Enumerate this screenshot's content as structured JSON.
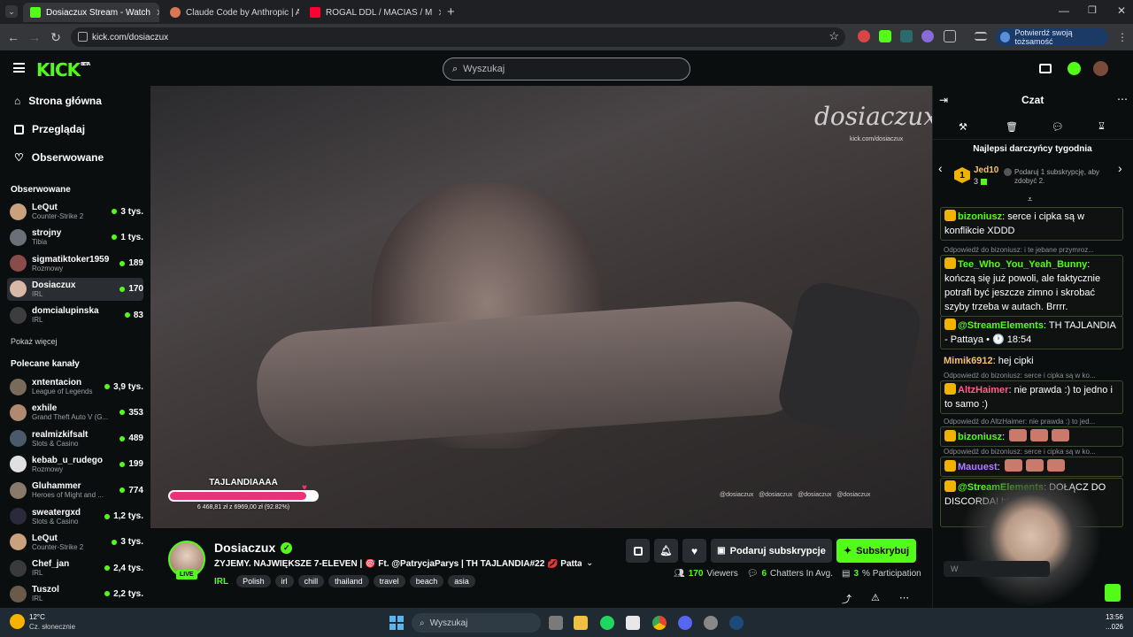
{
  "browser": {
    "tabs": [
      {
        "title": "Dosiaczux Stream - Watch",
        "active": true
      },
      {
        "title": "Claude Code by Anthropic | AI",
        "active": false
      },
      {
        "title": "ROGAL DDL / MACIAS / M",
        "active": false
      }
    ],
    "url": "kick.com/dosiaczux",
    "verify_label": "Potwierdź swoją tożsamość"
  },
  "header": {
    "logo": "KICK",
    "logo_sup": "BETA",
    "search_placeholder": "Wyszukaj"
  },
  "sidebar": {
    "nav": [
      {
        "label": "Strona główna",
        "icon": "home-icon"
      },
      {
        "label": "Przeglądaj",
        "icon": "browse-icon"
      },
      {
        "label": "Obserwowane",
        "icon": "heart-icon"
      }
    ],
    "followed_title": "Obserwowane",
    "followed": [
      {
        "name": "LeQut",
        "game": "Counter-Strike 2",
        "viewers": "3 tys.",
        "color": "#c9a27d"
      },
      {
        "name": "strojny",
        "game": "Tibia",
        "viewers": "1 tys.",
        "color": "#6b6f78"
      },
      {
        "name": "sigmatiktoker1959",
        "game": "Rozmowy",
        "viewers": "189",
        "color": "#8a4b4b"
      },
      {
        "name": "Dosiaczux",
        "game": "IRL",
        "viewers": "170",
        "color": "#d7b9a5"
      },
      {
        "name": "domcialupinska",
        "game": "IRL",
        "viewers": "83",
        "color": "#3d3d3d"
      }
    ],
    "show_more": "Pokaż więcej",
    "recommended_title": "Polecane kanały",
    "recommended": [
      {
        "name": "xntentacion",
        "game": "League of Legends",
        "viewers": "3,9 tys.",
        "color": "#7a6a5a"
      },
      {
        "name": "exhile",
        "game": "Grand Theft Auto V (G...",
        "viewers": "353",
        "color": "#b08a70"
      },
      {
        "name": "realmizkifsalt",
        "game": "Slots & Casino",
        "viewers": "489",
        "color": "#4a5a6a"
      },
      {
        "name": "kebab_u_rudego",
        "game": "Rozmowy",
        "viewers": "199",
        "color": "#e0e0e0"
      },
      {
        "name": "Gluhammer",
        "game": "Heroes of Might and ...",
        "viewers": "774",
        "color": "#8a7a6a"
      },
      {
        "name": "sweatergxd",
        "game": "Slots & Casino",
        "viewers": "1,2 tys.",
        "color": "#2a2a3a"
      },
      {
        "name": "LeQut",
        "game": "Counter-Strike 2",
        "viewers": "3 tys.",
        "color": "#c9a27d"
      },
      {
        "name": "Chef_jan",
        "game": "IRL",
        "viewers": "2,4 tys.",
        "color": "#3a3a3a"
      },
      {
        "name": "Tuszol",
        "game": "IRL",
        "viewers": "2,2 tys.",
        "color": "#6a5a4a"
      }
    ]
  },
  "video": {
    "watermark": "dosiaczux",
    "watermark_url": "kick.com/dosiaczux",
    "socials": "@dosiaczux   @dosiaczux   @dosiaczux   @dosiaczux",
    "goal_title": "TAJLANDIAAAA",
    "goal_progress": 0.9282,
    "goal_text": "6 468,81 zł z 6969,00 zł (92.82%)"
  },
  "stream": {
    "streamer": "Dosiaczux",
    "live_label": "LIVE",
    "title": "ŻYJEMY. NAJWIĘKSZE 7-ELEVEN | 🎯 Ft. @PatrycjaParys | TH TAJLANDIA#22 💋 Pattaya ...",
    "category": "IRL",
    "tags": [
      "Polish",
      "irl",
      "chill",
      "thailand",
      "travel",
      "beach",
      "asia"
    ],
    "gift_sub_label": "Podaruj subskrypcje",
    "subscribe_label": "Subskrybuj",
    "viewers": "170",
    "viewers_label": "Viewers",
    "chatters": "6",
    "chatters_label": "Chatters In Avg.",
    "participation": "3",
    "participation_label": "% Participation"
  },
  "chat": {
    "title": "Czat",
    "gifters_title": "Najlepsi darczyńcy tygodnia",
    "gifter_name": "Jed10",
    "gifter_count": "3",
    "gift_hint": "Podaruj 1 subskrypcję, aby zdobyć 2.",
    "messages": [
      {
        "reply": "",
        "user": "bizoniusz",
        "color": "#53fc18",
        "text": "serce i cipka są w konflikcie XDDD"
      },
      {
        "reply": "Odpowiedź do bizoniusz: i te jebane przymroz...",
        "user": "Tee_Who_You_Yeah_Bunny",
        "color": "#53fc18",
        "text": "kończą się już powoli, ale faktycznie potrafi być jeszcze zimno i skrobać szyby trzeba w autach. Brrrr."
      },
      {
        "reply": "",
        "user": "@StreamElements",
        "color": "#53fc18",
        "text": "TH TAJLANDIA - Pattaya • 🕐 18:54"
      },
      {
        "reply": "",
        "user": "Mimik6912",
        "color": "#f5c26b",
        "text": "hej cipki"
      },
      {
        "reply": "Odpowiedź do bizoniusz: serce i cipka są w ko...",
        "user": "AltzHaimer",
        "color": "#ff5f8a",
        "text": "nie prawda :) to jedno i to samo :)"
      },
      {
        "reply": "Odpowiedź do AltzHaimer: nie prawda :) to jed...",
        "user": "bizoniusz",
        "color": "#53fc18",
        "text": ""
      },
      {
        "reply": "Odpowiedź do bizoniusz: serce i cipka są w ko...",
        "user": "Mauuest",
        "color": "#b57bff",
        "text": ""
      },
      {
        "reply": "",
        "user": "@StreamElements",
        "color": "#53fc18",
        "text": "DOŁĄCZ DO DISCORDA! https://d..."
      }
    ]
  },
  "taskbar": {
    "weather_temp": "12°C",
    "weather_desc": "Cz. słonecznie",
    "search_label": "Wyszukaj",
    "time": "13:56",
    "date": "...026"
  },
  "colors": {
    "accent": "#53fc18",
    "background": "#0b0e0f"
  }
}
